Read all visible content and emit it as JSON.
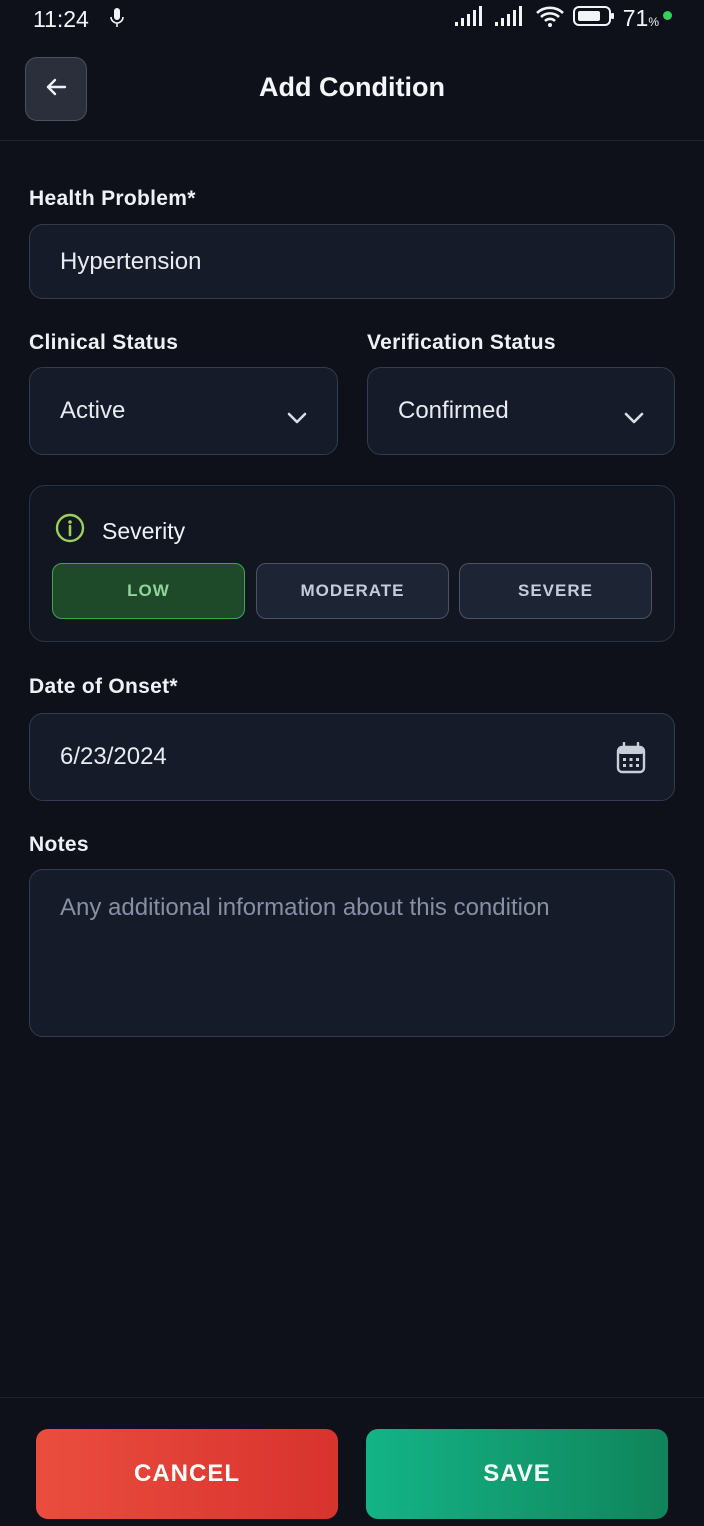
{
  "status_bar": {
    "time": "11:24",
    "battery_percent": "71",
    "battery_unit": "%",
    "icons": [
      "mic-icon",
      "signal-icon",
      "signal-icon",
      "wifi-icon",
      "battery-icon"
    ]
  },
  "header": {
    "back_icon": "arrow-left-icon",
    "title": "Add Condition"
  },
  "form": {
    "health_problem": {
      "label": "Health Problem*",
      "value": "Hypertension"
    },
    "clinical_status": {
      "label": "Clinical Status",
      "value": "Active"
    },
    "verification_status": {
      "label": "Verification Status",
      "value": "Confirmed"
    },
    "severity": {
      "label": "Severity",
      "icon": "info-icon",
      "options": [
        "LOW",
        "MODERATE",
        "SEVERE"
      ],
      "selected": "LOW"
    },
    "date_of_onset": {
      "label": "Date of Onset*",
      "value": "6/23/2024",
      "icon": "calendar-icon"
    },
    "notes": {
      "label": "Notes",
      "placeholder": "Any additional information about this condition",
      "value": ""
    }
  },
  "actions": {
    "cancel_label": "CANCEL",
    "save_label": "SAVE"
  },
  "colors": {
    "background": "#0e1119",
    "field_bg": "#151b29",
    "accent_green": "#3fa553",
    "cancel_red": "#e5433a",
    "save_green": "#12a574"
  }
}
